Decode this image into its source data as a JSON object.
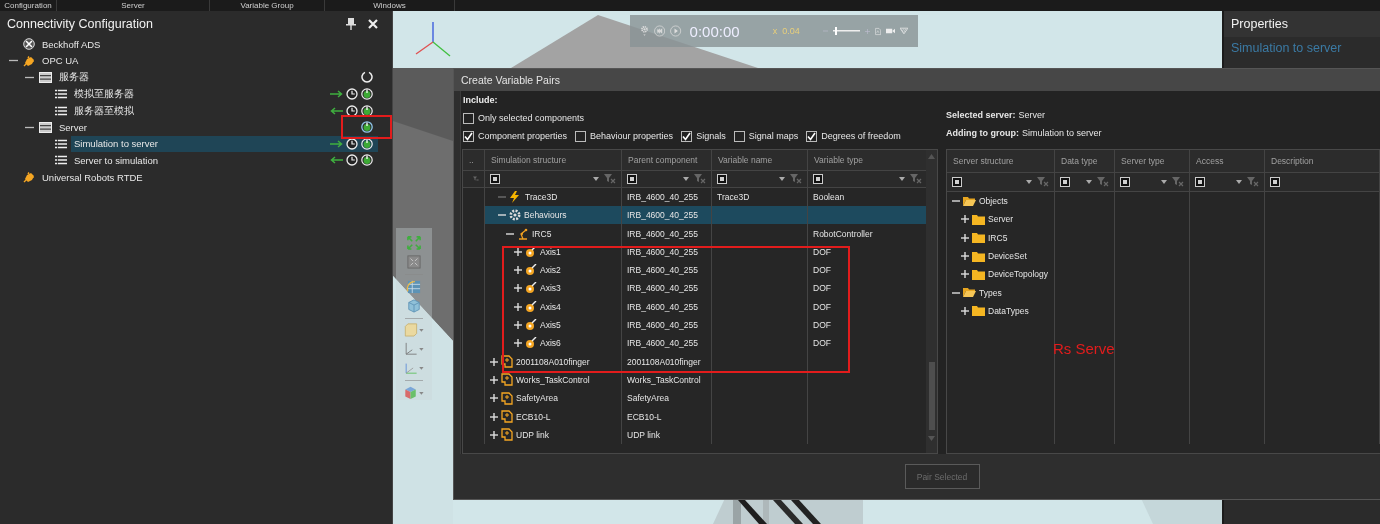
{
  "menu": [
    "Configuration",
    "Server",
    "Variable Group",
    "Windows"
  ],
  "connectivity": {
    "title": "Connectivity Configuration",
    "items": [
      {
        "label": "Beckhoff ADS",
        "kind": "ads",
        "selected": false
      },
      {
        "label": "OPC UA",
        "kind": "plugin",
        "expanded": true,
        "selected": false,
        "children": [
          {
            "label": "服务器",
            "kind": "server",
            "expanded": true,
            "connected": false,
            "selected": false,
            "children": [
              {
                "label": "模拟至服务器",
                "kind": "group",
                "to_server": true,
                "selected": false
              },
              {
                "label": "服务器至模拟",
                "kind": "group",
                "to_server": false,
                "selected": false
              }
            ]
          },
          {
            "label": "Server",
            "kind": "server",
            "expanded": true,
            "connected": true,
            "selected": false,
            "children": [
              {
                "label": "Simulation to server",
                "kind": "group",
                "to_server": true,
                "selected": true
              },
              {
                "label": "Server to simulation",
                "kind": "group",
                "to_server": false,
                "selected": false
              }
            ]
          }
        ]
      },
      {
        "label": "Universal Robots RTDE",
        "kind": "plugin",
        "selected": false
      }
    ]
  },
  "viewport": {
    "playback": {
      "time": "0:00:00",
      "speed_prefix": "x",
      "speed": "0.04",
      "zoom_slider": {
        "level": 0.08
      }
    }
  },
  "properties": {
    "title": "Properties",
    "selection": "Simulation to server"
  },
  "dialog": {
    "title": "Create Variable Pairs",
    "include_label": "Include:",
    "option_rows": [
      [
        {
          "label": "Only selected components",
          "checked": false
        }
      ],
      [
        {
          "label": "Component properties",
          "checked": true
        },
        {
          "label": "Behaviour properties",
          "checked": false
        },
        {
          "label": "Signals",
          "checked": true
        },
        {
          "label": "Signal maps",
          "checked": false
        },
        {
          "label": "Degrees of freedom",
          "checked": true
        }
      ]
    ],
    "selected_server": {
      "label": "Selected server:",
      "value": "Server"
    },
    "adding_to_group": {
      "label": "Adding to group:",
      "value": "Simulation to server"
    },
    "simulation_grid": {
      "columns": [
        {
          "label": ".."
        },
        {
          "label": "Simulation structure",
          "filter_partial": true
        },
        {
          "label": "Parent component",
          "filter_partial": true
        },
        {
          "label": "Variable name",
          "filter_partial": true
        },
        {
          "label": "Variable type",
          "filter_partial": true
        }
      ],
      "scrolled_branch": [
        {
          "name": "Trace3D",
          "kind": "signal",
          "parent": "IRB_4600_40_255",
          "variable_name": "Trace3D",
          "variable_type": "Boolean",
          "selected": false
        },
        {
          "name": "Behaviours",
          "kind": "behaviours",
          "parent": "IRB_4600_40_255",
          "expanded": true,
          "selected": true,
          "children": [
            {
              "name": "IRC5",
              "kind": "controller",
              "parent": "IRB_4600_40_255",
              "variable_type": "RobotController",
              "expanded": true,
              "selected": false,
              "children": [
                {
                  "name": "Axis1",
                  "kind": "axis",
                  "parent": "IRB_4600_40_255",
                  "variable_type": "DOF",
                  "expanded": false,
                  "selected": false
                },
                {
                  "name": "Axis2",
                  "kind": "axis",
                  "parent": "IRB_4600_40_255",
                  "variable_type": "DOF",
                  "expanded": false,
                  "selected": false
                },
                {
                  "name": "Axis3",
                  "kind": "axis",
                  "parent": "IRB_4600_40_255",
                  "variable_type": "DOF",
                  "expanded": false,
                  "selected": false
                },
                {
                  "name": "Axis4",
                  "kind": "axis",
                  "parent": "IRB_4600_40_255",
                  "variable_type": "DOF",
                  "expanded": false,
                  "selected": false
                },
                {
                  "name": "Axis5",
                  "kind": "axis",
                  "parent": "IRB_4600_40_255",
                  "variable_type": "DOF",
                  "expanded": false,
                  "selected": false
                },
                {
                  "name": "Axis6",
                  "kind": "axis",
                  "parent": "IRB_4600_40_255",
                  "variable_type": "DOF",
                  "expanded": false,
                  "selected": false
                }
              ]
            }
          ]
        }
      ],
      "rows": [
        {
          "name": "2001108A010finger",
          "kind": "component",
          "parent": "2001108A010finger",
          "expanded": false,
          "selected": false
        },
        {
          "name": "Works_TaskControl",
          "kind": "component",
          "parent": "Works_TaskControl",
          "expanded": false,
          "selected": false
        },
        {
          "name": "SafetyArea",
          "kind": "component",
          "parent": "SafetyArea",
          "expanded": false,
          "selected": false
        },
        {
          "name": "ECB10-L",
          "kind": "component",
          "parent": "ECB10-L",
          "expanded": false,
          "selected": false
        },
        {
          "name": "UDP link",
          "kind": "component",
          "parent": "UDP link",
          "expanded": false,
          "selected": false
        }
      ]
    },
    "server_grid": {
      "columns": [
        {
          "label": "Server structure",
          "filter_partial": true
        },
        {
          "label": "Data type",
          "filter_partial": true
        },
        {
          "label": "Server type",
          "filter_partial": true
        },
        {
          "label": "Access",
          "filter_partial": true
        },
        {
          "label": "Description",
          "filter_partial": true
        }
      ],
      "rows": [
        {
          "name": "Objects",
          "expanded": true,
          "children": [
            {
              "name": "Server",
              "expanded": false
            },
            {
              "name": "IRC5",
              "expanded": false
            },
            {
              "name": "DeviceSet",
              "expanded": false
            },
            {
              "name": "DeviceTopology",
              "expanded": false
            }
          ]
        },
        {
          "name": "Types",
          "expanded": true,
          "children": [
            {
              "name": "DataTypes",
              "expanded": false
            }
          ]
        }
      ]
    },
    "pair_button": {
      "label": "Pair Selected",
      "disabled": true
    }
  },
  "annotation": {
    "label": "Rs Serve"
  }
}
